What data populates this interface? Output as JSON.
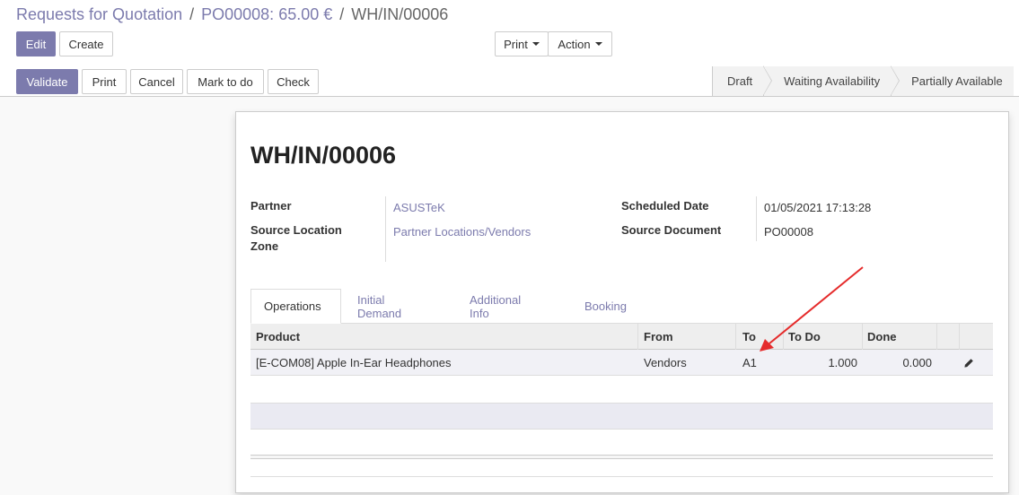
{
  "breadcrumb": {
    "root": "Requests for Quotation",
    "parent": "PO00008: 65.00 €",
    "current": "WH/IN/00006",
    "separator": "/"
  },
  "actions": {
    "edit": "Edit",
    "create": "Create",
    "print": "Print",
    "action": "Action"
  },
  "toolbar": {
    "validate": "Validate",
    "print": "Print",
    "cancel": "Cancel",
    "mark_todo": "Mark to do",
    "check": "Check"
  },
  "statusbar": [
    "Draft",
    "Waiting Availability",
    "Partially Available"
  ],
  "record": {
    "title": "WH/IN/00006",
    "partner_label": "Partner",
    "partner": "ASUSTeK",
    "source_location_label": "Source Location Zone",
    "source_location": "Partner Locations/Vendors",
    "scheduled_date_label": "Scheduled Date",
    "scheduled_date": "01/05/2021 17:13:28",
    "source_document_label": "Source Document",
    "source_document": "PO00008"
  },
  "tabs": [
    "Operations",
    "Initial Demand",
    "Additional Info",
    "Booking"
  ],
  "table": {
    "columns": [
      "Product",
      "From",
      "To",
      "To Do",
      "Done"
    ],
    "rows": [
      {
        "product": "[E-COM08] Apple In-Ear Headphones",
        "from": "Vendors",
        "to": "A1",
        "todo": "1.000",
        "done": "0.000"
      }
    ]
  },
  "colors": {
    "primary": "#7c7bad",
    "arrow": "#e52b2b"
  },
  "icons": {
    "edit_row": "pencil-icon",
    "annotation": "red-arrow"
  }
}
